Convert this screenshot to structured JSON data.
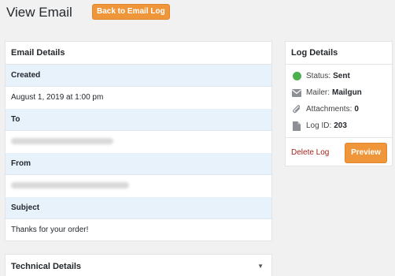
{
  "header": {
    "title": "View Email",
    "back_button_label": "Back to Email Log"
  },
  "email_details": {
    "title": "Email Details",
    "fields": [
      {
        "label": "Created",
        "value": "August 1, 2019 at 1:00 pm"
      },
      {
        "label": "To",
        "value": ""
      },
      {
        "label": "From",
        "value": ""
      },
      {
        "label": "Subject",
        "value": "Thanks for your order!"
      }
    ]
  },
  "log_details": {
    "title": "Log Details",
    "status_label": "Status:",
    "status_value": "Sent",
    "mailer_label": "Mailer:",
    "mailer_value": "Mailgun",
    "attachments_label": "Attachments:",
    "attachments_value": "0",
    "log_id_label": "Log ID:",
    "log_id_value": "203",
    "delete_label": "Delete Log",
    "preview_label": "Preview",
    "status_color": "#4caf50"
  },
  "technical_details": {
    "title": "Technical Details"
  }
}
